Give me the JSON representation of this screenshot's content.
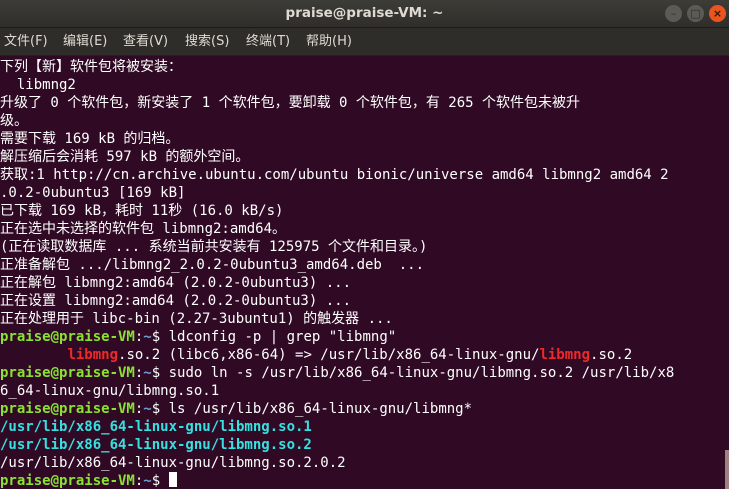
{
  "window": {
    "title": "praise@praise-VM: ~"
  },
  "window_controls": {
    "minimize": "–",
    "maximize": "□",
    "close": "×"
  },
  "menu": {
    "file": "文件(F)",
    "edit": "编辑(E)",
    "view": "查看(V)",
    "search": "搜索(S)",
    "terminal": "终端(T)",
    "help": "帮助(H)"
  },
  "prompt": {
    "user": "praise@praise-VM",
    "path": "~",
    "symbol": "$"
  },
  "terminal": {
    "l1": "下列【新】软件包将被安装：",
    "l2": "  libmng2",
    "l3": "升级了 0 个软件包，新安装了 1 个软件包，要卸载 0 个软件包，有 265 个软件包未被升",
    "l4": "级。",
    "l5": "需要下载 169 kB 的归档。",
    "l6": "解压缩后会消耗 597 kB 的额外空间。",
    "l7": "获取:1 http://cn.archive.ubuntu.com/ubuntu bionic/universe amd64 libmng2 amd64 2",
    "l8": ".0.2-0ubuntu3 [169 kB]",
    "l9": "已下载 169 kB，耗时 11秒 (16.0 kB/s)",
    "l10": "正在选中未选择的软件包 libmng2:amd64。",
    "l11": "(正在读取数据库 ... 系统当前共安装有 125975 个文件和目录。)",
    "l12": "正准备解包 .../libmng2_2.0.2-0ubuntu3_amd64.deb  ...",
    "l13": "正在解包 libmng2:amd64 (2.0.2-0ubuntu3) ...",
    "l14": "正在设置 libmng2:amd64 (2.0.2-0ubuntu3) ...",
    "l15": "正在处理用于 libc-bin (2.27-3ubuntu1) 的触发器 ...",
    "cmd1": " ldconfig -p | grep \"libmng\"",
    "l17_indent": "        ",
    "l17_a": "libmng",
    "l17_b": ".so.2 (libc6,x86-64) => /usr/lib/x86_64-linux-gnu/",
    "l17_c": "libmng",
    "l17_d": ".so.2",
    "cmd2": " sudo ln -s /usr/lib/x86_64-linux-gnu/libmng.so.2 /usr/lib/x8",
    "l19": "6_64-linux-gnu/libmng.so.1",
    "cmd3": " ls /usr/lib/x86_64-linux-gnu/libmng*",
    "ls1": "/usr/lib/x86_64-linux-gnu/libmng.so.1",
    "ls2": "/usr/lib/x86_64-linux-gnu/libmng.so.2",
    "ls3": "/usr/lib/x86_64-linux-gnu/libmng.so.2.0.2",
    "final": " "
  }
}
